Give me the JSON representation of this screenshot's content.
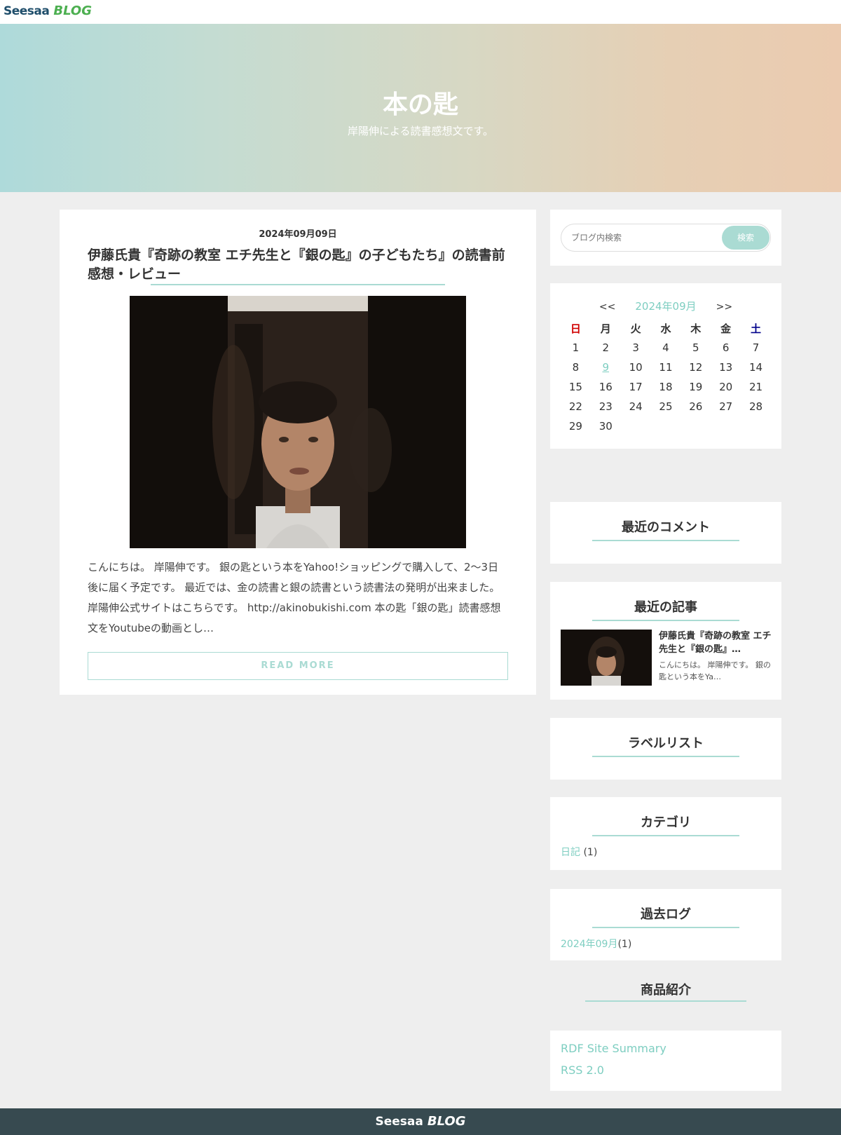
{
  "header": {
    "logo_text": "Seesaa",
    "logo_blog": "BLOG"
  },
  "hero": {
    "title": "本の匙",
    "subtitle": "岸陽伸による読書感想文です。"
  },
  "post": {
    "date": "2024年09月09日",
    "title": "伊藤氏貴『奇跡の教室 エチ先生と『銀の匙』の子どもたち』の読書前感想・レビュー",
    "excerpt": "こんにちは。 岸陽伸です。 銀の匙という本をYahoo!ショッピングで購入して、2〜3日後に届く予定です。 最近では、金の読書と銀の読書という読書法の発明が出来ました。 岸陽伸公式サイトはこちらです。 http://akinobukishi.com 本の匙「銀の匙」読書感想文をYoutubeの動画とし…",
    "read_more": "READ MORE"
  },
  "search": {
    "placeholder": "ブログ内検索",
    "button": "検索"
  },
  "calendar": {
    "prev": "<<",
    "title": "2024年09月",
    "next": ">>",
    "weekdays": [
      "日",
      "月",
      "火",
      "水",
      "木",
      "金",
      "土"
    ],
    "weeks": [
      [
        "1",
        "2",
        "3",
        "4",
        "5",
        "6",
        "7"
      ],
      [
        "8",
        "9",
        "10",
        "11",
        "12",
        "13",
        "14"
      ],
      [
        "15",
        "16",
        "17",
        "18",
        "19",
        "20",
        "21"
      ],
      [
        "22",
        "23",
        "24",
        "25",
        "26",
        "27",
        "28"
      ],
      [
        "29",
        "30",
        "",
        "",
        "",
        "",
        ""
      ]
    ],
    "linked_day": "9"
  },
  "widgets": {
    "comments_title": "最近のコメント",
    "recent_title": "最近の記事",
    "recent_post_title": "伊藤氏貴『奇跡の教室 エチ先生と『銀の匙』…",
    "recent_post_text": "こんにちは。 岸陽伸です。 銀の匙という本をYa…",
    "labels_title": "ラベルリスト",
    "categories_title": "カテゴリ",
    "category_name": "日記",
    "category_count": "(1)",
    "archive_title": "過去ログ",
    "archive_name": "2024年09月",
    "archive_count": "(1)",
    "products_title": "商品紹介",
    "rdf_link": "RDF Site Summary",
    "rss_link": "RSS 2.0"
  },
  "footer": {
    "logo_text": "Seesaa",
    "logo_blog": "BLOG"
  },
  "colors": {
    "accent": "#7ecec1",
    "accent_line": "#aadbd3",
    "footer_bg": "#374a50",
    "page_bg": "#eeeeee"
  }
}
